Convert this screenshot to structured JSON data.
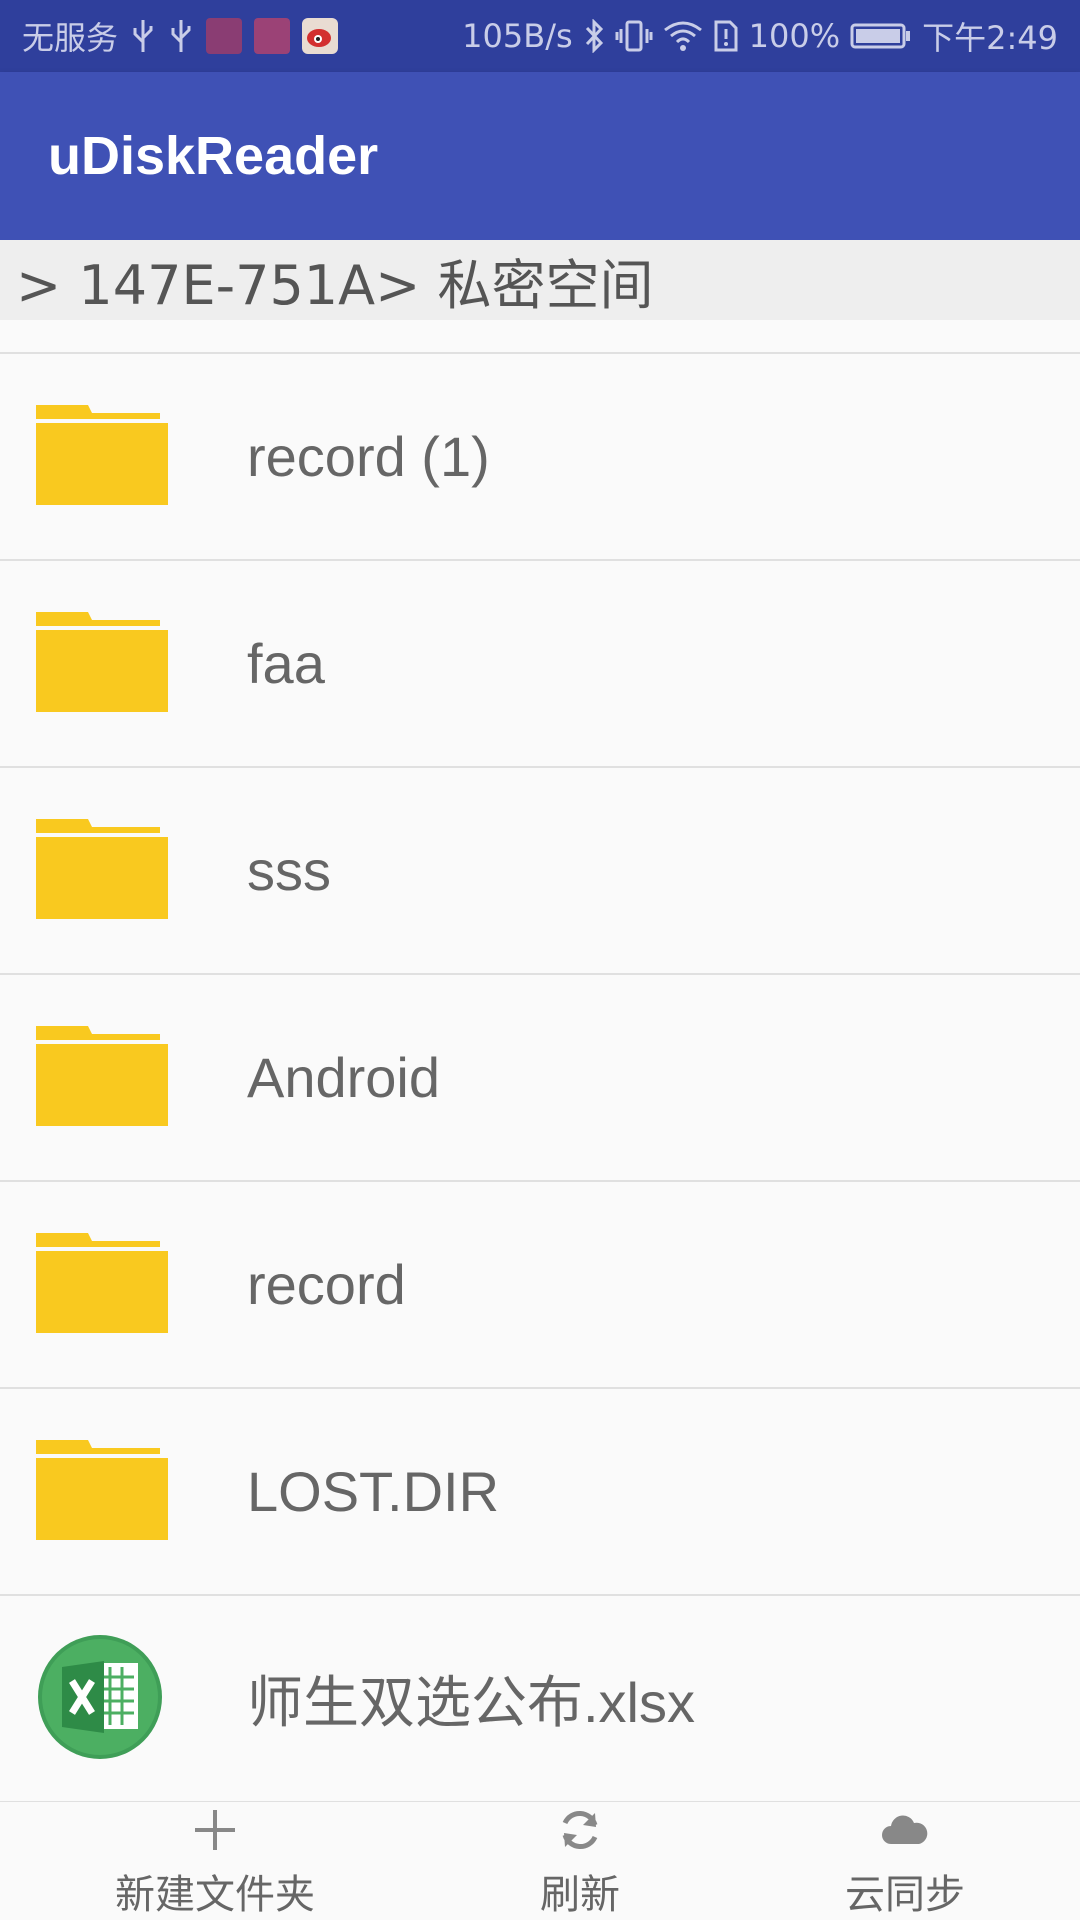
{
  "status_bar": {
    "carrier": "无服务",
    "net_speed": "105B/s",
    "battery": "100%",
    "time": "下午2:49",
    "icons": [
      "usb-icon",
      "usb-icon",
      "huawei-app-icon",
      "huawei-app-icon",
      "weibo-icon",
      "bluetooth-icon",
      "vibrate-icon",
      "wifi-icon",
      "sim-icon",
      "battery-icon"
    ]
  },
  "app_bar": {
    "title": "uDiskReader"
  },
  "breadcrumb": {
    "path": "> 147E-751A> 私密空间"
  },
  "files": [
    {
      "name": "record (1)",
      "type": "folder",
      "icon": "folder-icon"
    },
    {
      "name": "faa",
      "type": "folder",
      "icon": "folder-icon"
    },
    {
      "name": "sss",
      "type": "folder",
      "icon": "folder-icon"
    },
    {
      "name": "Android",
      "type": "folder",
      "icon": "folder-icon"
    },
    {
      "name": "record",
      "type": "folder",
      "icon": "folder-icon"
    },
    {
      "name": "LOST.DIR",
      "type": "folder",
      "icon": "folder-icon"
    },
    {
      "name": "师生双选公布.xlsx",
      "type": "excel",
      "icon": "excel-icon"
    }
  ],
  "bottom_bar": {
    "new_folder_label": "新建文件夹",
    "refresh_label": "刷新",
    "cloud_sync_label": "云同步"
  },
  "colors": {
    "status_bar": "#2f3f9c",
    "app_bar": "#3f51b5",
    "folder": "#f9c91f",
    "excel": "#4caf50"
  }
}
